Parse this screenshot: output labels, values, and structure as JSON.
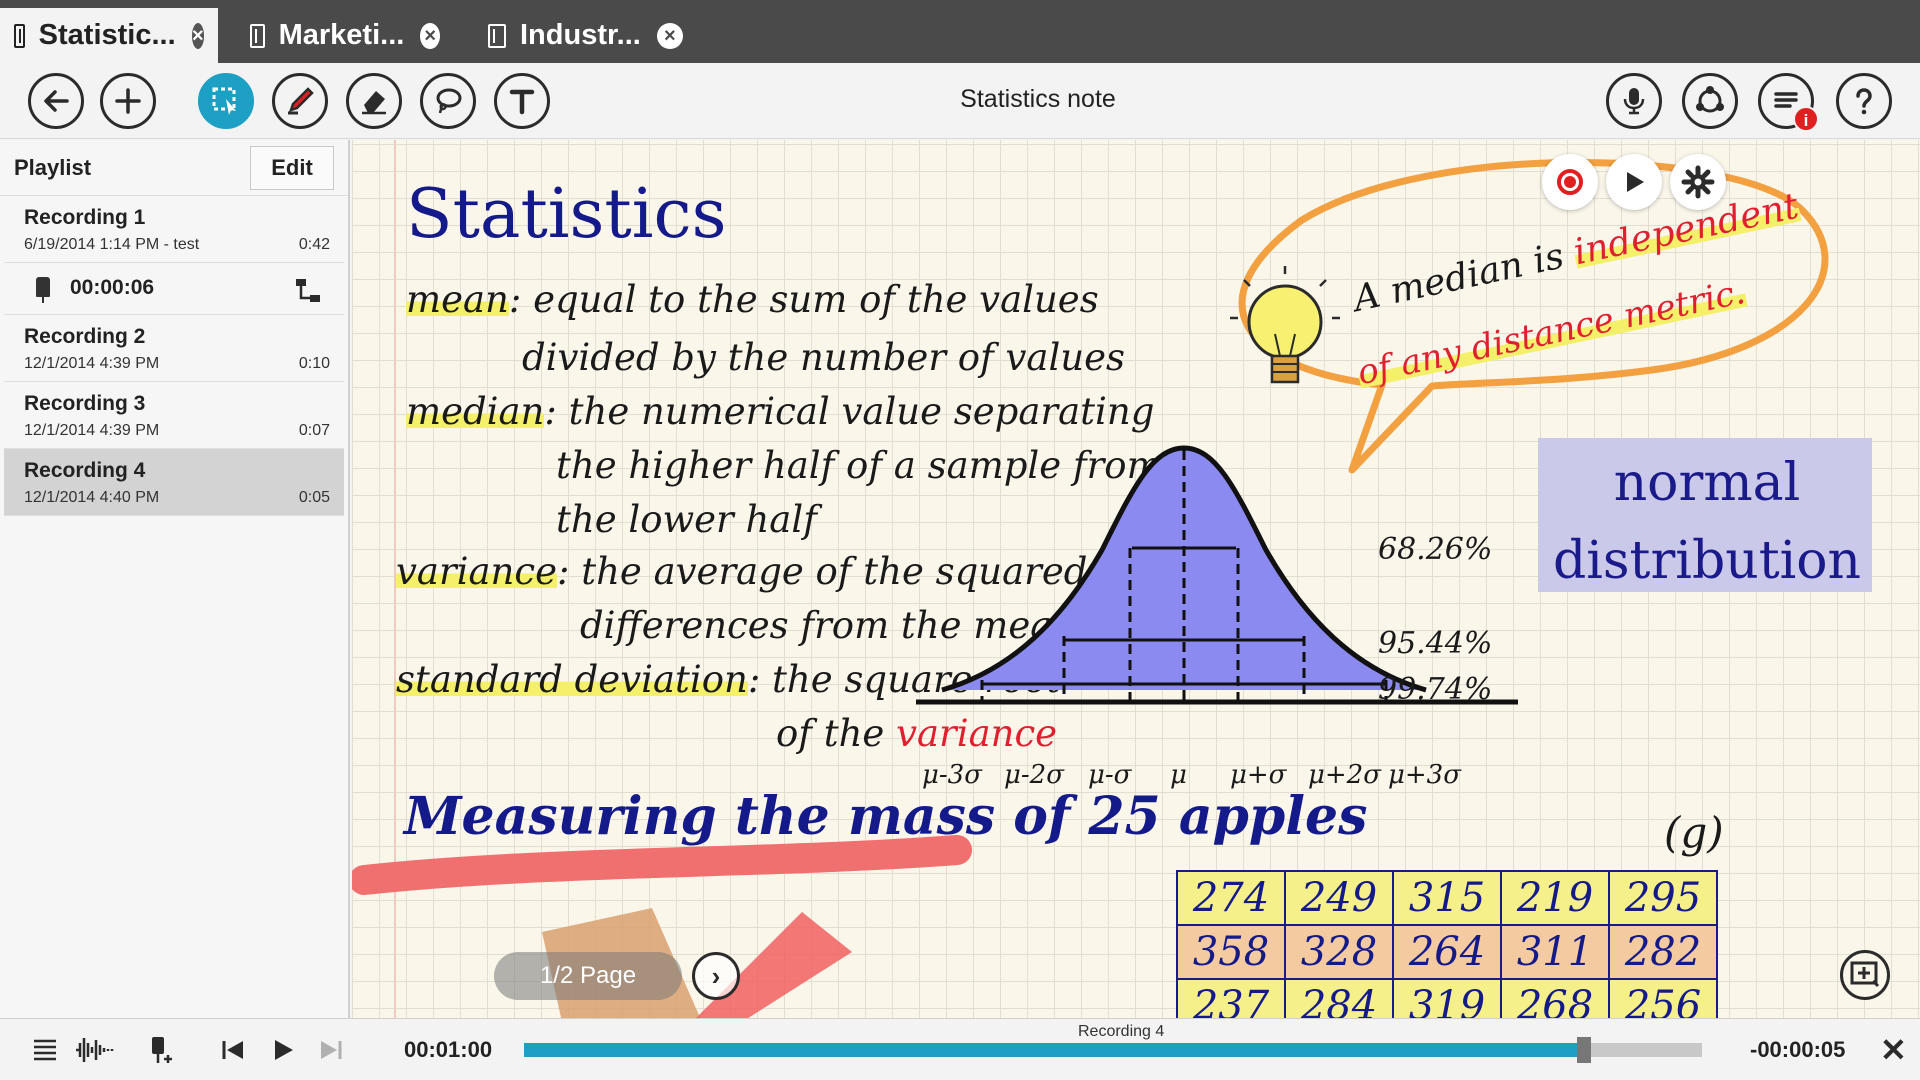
{
  "tabs": [
    {
      "label": "Statistic...",
      "active": true
    },
    {
      "label": "Marketi...",
      "active": false
    },
    {
      "label": "Industr...",
      "active": false
    }
  ],
  "toolbar": {
    "title": "Statistics note",
    "left_tools": [
      "back-arrow-icon",
      "add-icon",
      "selection-tool-icon",
      "pen-icon",
      "eraser-icon",
      "lasso-icon",
      "text-tool-icon"
    ],
    "right_tools": [
      "microphone-icon",
      "share-icon",
      "menu-icon",
      "help-icon"
    ],
    "menu_badge": "i",
    "accent_color": "#1e9fc4"
  },
  "playlist": {
    "title": "Playlist",
    "edit_label": "Edit",
    "recordings": [
      {
        "name": "Recording 1",
        "meta": "6/19/2014 1:14 PM - test",
        "duration": "0:42"
      },
      {
        "name": "Recording 2",
        "meta": "12/1/2014 4:39 PM",
        "duration": "0:10"
      },
      {
        "name": "Recording 3",
        "meta": "12/1/2014 4:39 PM",
        "duration": "0:07"
      },
      {
        "name": "Recording 4",
        "meta": "12/1/2014 4:40 PM",
        "duration": "0:05",
        "selected": true
      }
    ],
    "marker_time": "00:00:06"
  },
  "note": {
    "title": "Statistics",
    "definitions": {
      "mean_term": "mean",
      "mean_l1": ": equal to the sum of the values",
      "mean_l2": "divided by the number of values",
      "median_term": "median",
      "median_l1": ": the numerical value separating",
      "median_l2": "the higher half of a sample from",
      "median_l3": "the lower half",
      "variance_term": "variance",
      "variance_l1": ": the average of the squared",
      "variance_l2": "differences from the mean",
      "sd_term": "standard deviation",
      "sd_l1": ": the square root",
      "sd_l2": "of the",
      "sd_l2_red": "variance"
    },
    "bubble": {
      "line1": "A median is",
      "line1_red": "independent",
      "line2_red": "of any distance metric."
    },
    "distribution_label_1": "normal",
    "distribution_label_2": "distribution",
    "distribution": {
      "pct_inner": "68.26%",
      "pct_mid": "95.44%",
      "pct_outer": "99.74%",
      "axis_labels": [
        "μ-3σ",
        "μ-2σ",
        "μ-σ",
        "μ",
        "μ+σ",
        "μ+2σ",
        "μ+3σ"
      ],
      "fill_color": "#8a8af0"
    },
    "measuring_title": "Measuring the mass of 25 apples",
    "unit": "(g)",
    "mass_table": [
      [
        "274",
        "249",
        "315",
        "219",
        "295"
      ],
      [
        "358",
        "328",
        "264",
        "311",
        "282"
      ],
      [
        "237",
        "284",
        "319",
        "268",
        "256"
      ]
    ],
    "page_indicator": "1/2 Page"
  },
  "player": {
    "current_time": "00:01:00",
    "remaining_time": "-00:00:05",
    "track_name": "Recording 4",
    "progress": 0.9
  }
}
